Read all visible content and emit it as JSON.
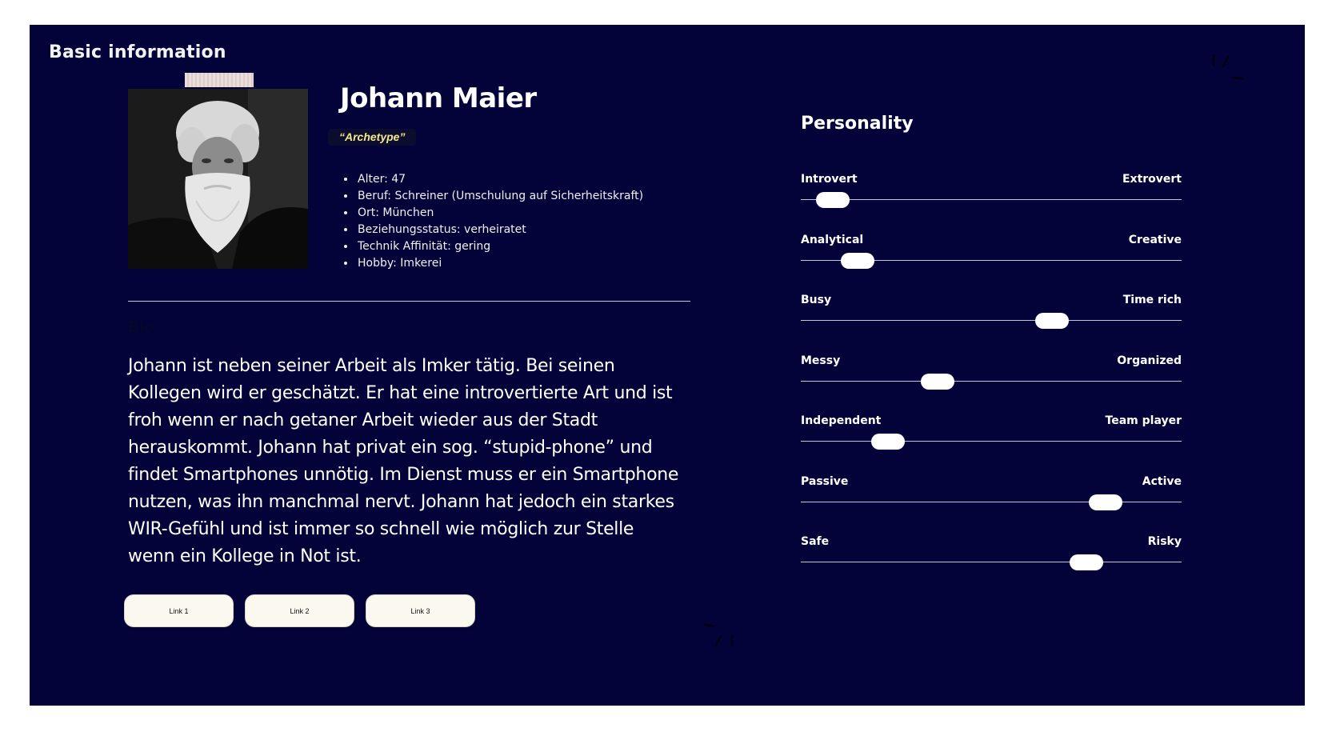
{
  "header": {
    "section_title": "Basic information"
  },
  "profile": {
    "name": "Johann Maier",
    "archetype": "“Archetype”",
    "facts": [
      "Alter: 47",
      "Beruf: Schreiner (Umschulung auf Sicherheitskraft)",
      "Ort: München",
      "Beziehungsstatus: verheiratet",
      "Technik Affinität: gering",
      "Hobby: Imkerei"
    ]
  },
  "bio": {
    "heading": "Bio",
    "text": "Johann ist neben seiner Arbeit als Imker tätig. Bei seinen Kollegen wird er geschätzt. Er hat eine introvertierte Art und ist froh wenn er nach getaner Arbeit wieder aus der Stadt herauskommt. Johann hat privat ein sog. “stupid-phone” und findet Smartphones unnötig. Im Dienst muss er ein Smartphone nutzen, was ihn manchmal nervt. Johann hat jedoch ein starkes WIR-Gefühl und ist immer so schnell wie möglich zur Stelle wenn ein Kollege in Not ist."
  },
  "links": [
    "Link 1",
    "Link 2",
    "Link 3"
  ],
  "personality": {
    "title": "Personality",
    "traits": [
      {
        "left": "Introvert",
        "right": "Extrovert",
        "value": 0.085
      },
      {
        "left": "Analytical",
        "right": "Creative",
        "value": 0.15
      },
      {
        "left": "Busy",
        "right": "Time rich",
        "value": 0.66
      },
      {
        "left": "Messy",
        "right": "Organized",
        "value": 0.36
      },
      {
        "left": "Independent",
        "right": "Team player",
        "value": 0.23
      },
      {
        "left": "Passive",
        "right": "Active",
        "value": 0.8
      },
      {
        "left": "Safe",
        "right": "Risky",
        "value": 0.75
      }
    ]
  },
  "colors": {
    "panel_background": "#03033a",
    "archetype_text": "#f2e98a",
    "button_background": "#fbf8ef",
    "slider_thumb": "#ffffff"
  }
}
